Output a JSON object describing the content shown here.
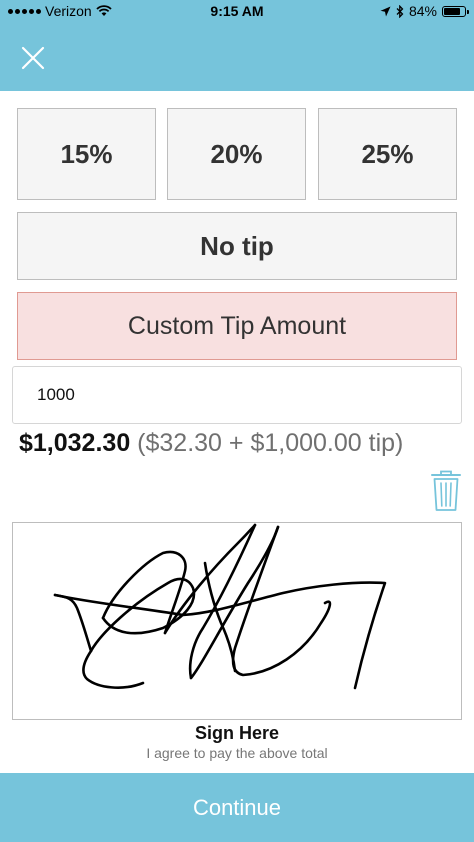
{
  "status_bar": {
    "carrier": "Verizon",
    "time": "9:15 AM",
    "battery": "84%",
    "battery_level": 0.84,
    "icons": [
      "signal-dots-icon",
      "wifi-icon",
      "location-arrow-icon",
      "bluetooth-icon",
      "battery-icon"
    ]
  },
  "header": {
    "close_icon": "close-icon"
  },
  "tip_options": [
    {
      "label": "15%"
    },
    {
      "label": "20%"
    },
    {
      "label": "25%"
    }
  ],
  "no_tip_label": "No tip",
  "custom_tip_label": "Custom Tip Amount",
  "custom_tip_value": "1000",
  "total": {
    "amount": "$1,032.30",
    "breakdown": "($32.30 + $1,000.00 tip)"
  },
  "clear_signature_icon": "trash-icon",
  "signature": {
    "title": "Sign Here",
    "subtitle": "I agree to pay the above total"
  },
  "continue_label": "Continue",
  "colors": {
    "header": "#76c4db",
    "custom_tip_bg": "#f8e0e0",
    "custom_tip_border": "#e09a92",
    "trash": "#76c4db"
  }
}
